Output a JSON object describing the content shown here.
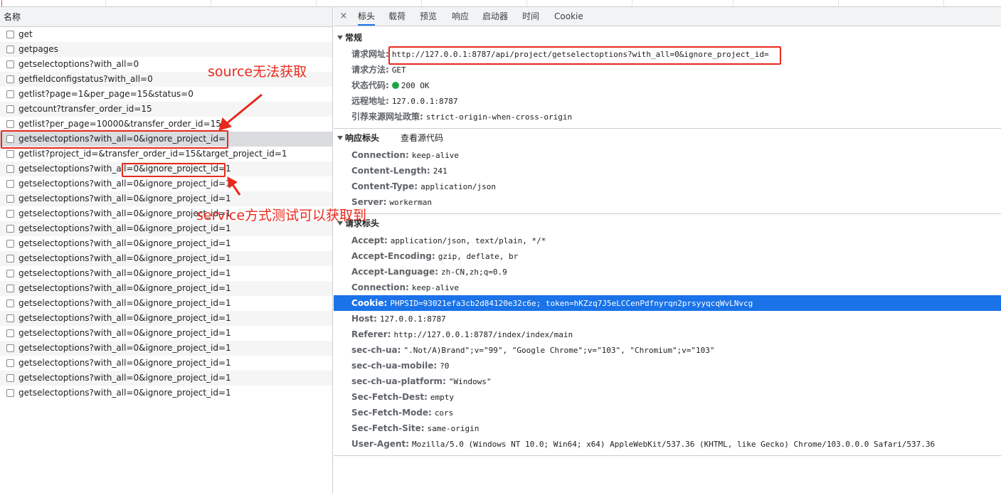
{
  "list": {
    "header": "名称",
    "items": [
      "get",
      "getpages",
      "getselectoptions?with_all=0",
      "getfieldconfigstatus?with_all=0",
      "getlist?page=1&per_page=15&status=0",
      "getcount?transfer_order_id=15",
      "getlist?per_page=10000&transfer_order_id=15",
      "getselectoptions?with_all=0&ignore_project_id=",
      "getlist?project_id=&transfer_order_id=15&target_project_id=1",
      "getselectoptions?with_all=0&ignore_project_id=1",
      "getselectoptions?with_all=0&ignore_project_id=1",
      "getselectoptions?with_all=0&ignore_project_id=1",
      "getselectoptions?with_all=0&ignore_project_id=1",
      "getselectoptions?with_all=0&ignore_project_id=1",
      "getselectoptions?with_all=0&ignore_project_id=1",
      "getselectoptions?with_all=0&ignore_project_id=1",
      "getselectoptions?with_all=0&ignore_project_id=1",
      "getselectoptions?with_all=0&ignore_project_id=1",
      "getselectoptions?with_all=0&ignore_project_id=1",
      "getselectoptions?with_all=0&ignore_project_id=1",
      "getselectoptions?with_all=0&ignore_project_id=1",
      "getselectoptions?with_all=0&ignore_project_id=1",
      "getselectoptions?with_all=0&ignore_project_id=1",
      "getselectoptions?with_all=0&ignore_project_id=1",
      "getselectoptions?with_all=0&ignore_project_id=1"
    ],
    "selected_index": 7
  },
  "tabs": {
    "close": "×",
    "items": [
      "标头",
      "载荷",
      "预览",
      "响应",
      "启动器",
      "时间",
      "Cookie"
    ],
    "active_index": 0
  },
  "general": {
    "title": "常规",
    "rows": [
      {
        "k": "请求网址:",
        "v": "http://127.0.0.1:8787/api/project/getselectoptions?with_all=0&ignore_project_id="
      },
      {
        "k": "请求方法:",
        "v": "GET"
      },
      {
        "k": "状态代码:",
        "v": "200 OK"
      },
      {
        "k": "远程地址:",
        "v": "127.0.0.1:8787"
      },
      {
        "k": "引荐来源网址政策:",
        "v": "strict-origin-when-cross-origin"
      }
    ]
  },
  "response_headers": {
    "title": "响应标头",
    "view_source": "查看源代码",
    "rows": [
      {
        "k": "Connection:",
        "v": "keep-alive"
      },
      {
        "k": "Content-Length:",
        "v": "241"
      },
      {
        "k": "Content-Type:",
        "v": "application/json"
      },
      {
        "k": "Server:",
        "v": "workerman"
      }
    ]
  },
  "request_headers": {
    "title": "请求标头",
    "rows": [
      {
        "k": "Accept:",
        "v": "application/json, text/plain, */*"
      },
      {
        "k": "Accept-Encoding:",
        "v": "gzip, deflate, br"
      },
      {
        "k": "Accept-Language:",
        "v": "zh-CN,zh;q=0.9"
      },
      {
        "k": "Connection:",
        "v": "keep-alive"
      },
      {
        "k": "Cookie:",
        "v": "PHPSID=93021efa3cb2d84120e32c6e; token=hKZzq7J5eLCCenPdfnyrqn2prsyyqcqWvLNvcg"
      },
      {
        "k": "Host:",
        "v": "127.0.0.1:8787"
      },
      {
        "k": "Referer:",
        "v": "http://127.0.0.1:8787/index/index/main"
      },
      {
        "k": "sec-ch-ua:",
        "v": "\".Not/A)Brand\";v=\"99\", \"Google Chrome\";v=\"103\", \"Chromium\";v=\"103\""
      },
      {
        "k": "sec-ch-ua-mobile:",
        "v": "?0"
      },
      {
        "k": "sec-ch-ua-platform:",
        "v": "\"Windows\""
      },
      {
        "k": "Sec-Fetch-Dest:",
        "v": "empty"
      },
      {
        "k": "Sec-Fetch-Mode:",
        "v": "cors"
      },
      {
        "k": "Sec-Fetch-Site:",
        "v": "same-origin"
      },
      {
        "k": "User-Agent:",
        "v": "Mozilla/5.0 (Windows NT 10.0; Win64; x64) AppleWebKit/537.36 (KHTML, like Gecko) Chrome/103.0.0.0 Safari/537.36"
      }
    ],
    "highlighted_index": 4
  },
  "annotations": {
    "top": "source无法获取",
    "bottom": "service方式测试可以获取到"
  },
  "colors": {
    "annotation_red": "#e8291c",
    "selected_blue": "#1a73e8",
    "status_green": "#1ea446"
  }
}
